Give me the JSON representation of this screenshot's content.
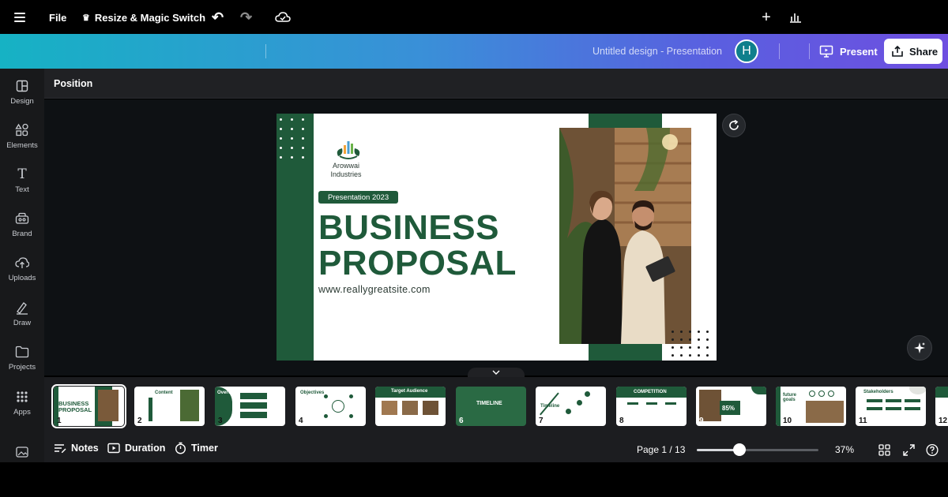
{
  "topbar": {
    "file_label": "File",
    "resize_label": "Resize & Magic Switch",
    "doc_title": "Untitled design - Presentation",
    "avatar_initial": "H",
    "present_label": "Present",
    "share_label": "Share",
    "gradient_start": "#16b2c4",
    "gradient_end": "#6e4fe0"
  },
  "sidebar": {
    "items": [
      {
        "label": "Design",
        "icon": "design-icon"
      },
      {
        "label": "Elements",
        "icon": "elements-icon"
      },
      {
        "label": "Text",
        "icon": "text-icon"
      },
      {
        "label": "Brand",
        "icon": "brand-icon"
      },
      {
        "label": "Uploads",
        "icon": "uploads-icon"
      },
      {
        "label": "Draw",
        "icon": "draw-icon"
      },
      {
        "label": "Projects",
        "icon": "projects-icon"
      },
      {
        "label": "Apps",
        "icon": "apps-icon"
      }
    ]
  },
  "context_toolbar": {
    "position_label": "Position"
  },
  "slide": {
    "company": "Arowwai Industries",
    "pill": "Presentation 2023",
    "headline_line1": "BUSINESS",
    "headline_line2": "PROPOSAL",
    "website": "www.reallygreatsite.com",
    "accent_color": "#1f5a3a"
  },
  "filmstrip": {
    "thumbnails": [
      {
        "number": "1",
        "tag": "BUSINESS PROPOSAL",
        "active": true
      },
      {
        "number": "2",
        "tag": "Content"
      },
      {
        "number": "3",
        "tag": "Overview"
      },
      {
        "number": "4",
        "tag": "Objectives"
      },
      {
        "number": "5",
        "tag": "Target Audience"
      },
      {
        "number": "6",
        "tag": "TIMELINE"
      },
      {
        "number": "7",
        "tag": "Timeline"
      },
      {
        "number": "8",
        "tag": "COMPETITION"
      },
      {
        "number": "9",
        "tag": "85%"
      },
      {
        "number": "10",
        "tag": "future goals"
      },
      {
        "number": "11",
        "tag": "Stakeholders"
      },
      {
        "number": "12",
        "tag": ""
      }
    ]
  },
  "bottombar": {
    "notes_label": "Notes",
    "duration_label": "Duration",
    "timer_label": "Timer",
    "page_label": "Page 1 / 13",
    "zoom_label": "37%",
    "zoom_percent": 37
  }
}
